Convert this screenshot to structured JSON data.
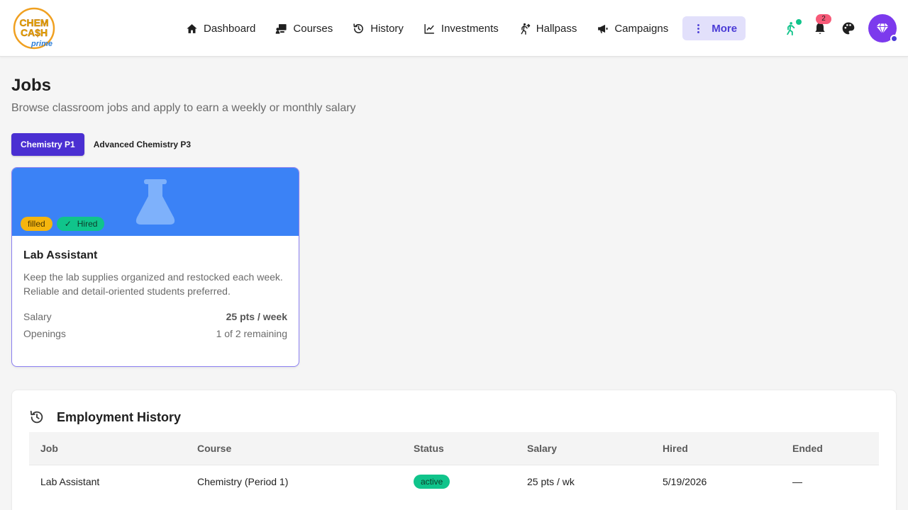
{
  "nav": {
    "logo": {
      "line1": "CHEM",
      "line2": "CA$H",
      "line3": "prime",
      "ring_color": "#f0a020",
      "text_color": "#e8a800",
      "accent_color": "#2f7fd8"
    },
    "items": [
      {
        "label": "Dashboard",
        "icon": "home-icon"
      },
      {
        "label": "Courses",
        "icon": "courses-icon"
      },
      {
        "label": "History",
        "icon": "history-icon"
      },
      {
        "label": "Investments",
        "icon": "chart-line-icon"
      },
      {
        "label": "Hallpass",
        "icon": "walking-person-icon"
      },
      {
        "label": "Campaigns",
        "icon": "megaphone-icon"
      },
      {
        "label": "More",
        "icon": "vertical-dots-icon",
        "active": true
      }
    ],
    "notifications_count": "2",
    "accent_color": "#4a3bd6",
    "avatar_color": "#7c3aed"
  },
  "page": {
    "title": "Jobs",
    "subtitle": "Browse classroom jobs and apply to earn a weekly or monthly salary"
  },
  "tabs": [
    {
      "label": "Chemistry P1",
      "active": true
    },
    {
      "label": "Advanced Chemistry P3",
      "active": false
    }
  ],
  "job_card": {
    "banner_color": "#3b82f6",
    "icon": "flask-icon",
    "badge_filled": "filled",
    "badge_hired_check": "✓",
    "badge_hired": "Hired",
    "title": "Lab Assistant",
    "description": "Keep the lab supplies organized and restocked each week. Reliable and detail-oriented students preferred.",
    "salary_label": "Salary",
    "salary_value": "25 pts / week",
    "openings_label": "Openings",
    "openings_value": "1 of 2 remaining"
  },
  "history": {
    "title": "Employment History",
    "icon": "history-icon",
    "columns": [
      "Job",
      "Course",
      "Status",
      "Salary",
      "Hired",
      "Ended"
    ],
    "rows": [
      {
        "job": "Lab Assistant",
        "course": "Chemistry (Period 1)",
        "status": "active",
        "salary": "25 pts / wk",
        "hired": "5/19/2026",
        "ended": "—"
      }
    ]
  }
}
